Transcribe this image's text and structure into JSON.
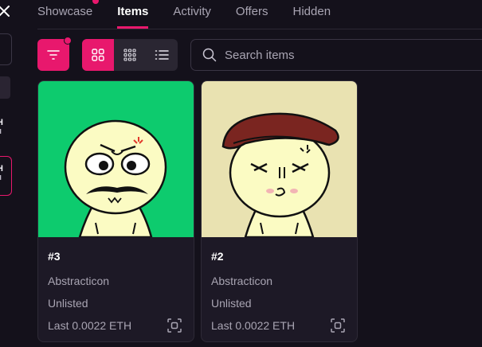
{
  "sidebar": {
    "prices": [
      {
        "value": "H",
        "unit": "H"
      },
      {
        "value": "H",
        "unit": "H"
      }
    ]
  },
  "tabs": [
    "Showcase",
    "Items",
    "Activity",
    "Offers",
    "Hidden"
  ],
  "active_tab": "Items",
  "search": {
    "placeholder": "Search items"
  },
  "items": [
    {
      "name": "#3",
      "collection": "Abstracticon",
      "status": "Unlisted",
      "last": "Last 0.0022 ETH",
      "bg": "#0dcb6e"
    },
    {
      "name": "#2",
      "collection": "Abstracticon",
      "status": "Unlisted",
      "last": "Last 0.0022 ETH",
      "bg": "#e9e2b1"
    }
  ],
  "colors": {
    "accent": "#e8186d",
    "background": "#14111b",
    "card": "#1d1926"
  }
}
